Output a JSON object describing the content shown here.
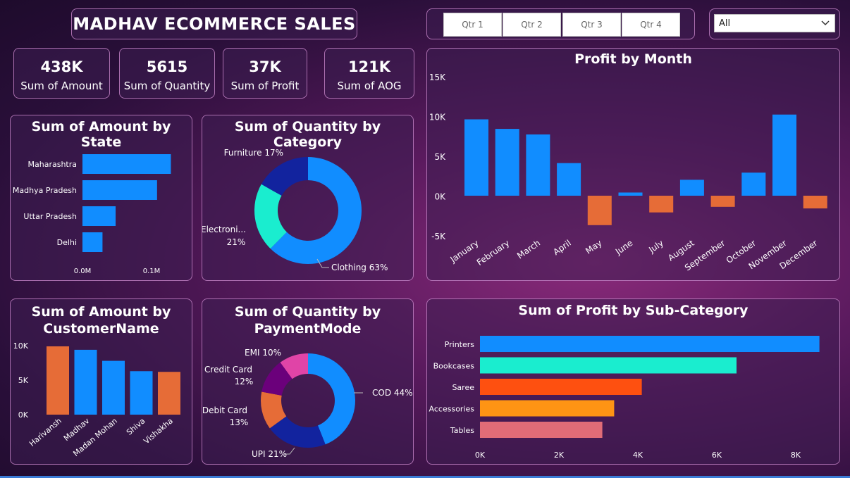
{
  "dashboard": {
    "title": "MADHAV ECOMMERCE SALES"
  },
  "kpis": [
    {
      "value": "438K",
      "label": "Sum of Amount"
    },
    {
      "value": "5615",
      "label": "Sum of Quantity"
    },
    {
      "value": "37K",
      "label": "Sum of Profit"
    },
    {
      "value": "121K",
      "label": "Sum of AOG"
    }
  ],
  "quarters": [
    "Qtr 1",
    "Qtr 2",
    "Qtr 3",
    "Qtr 4"
  ],
  "filter": {
    "selected": "All"
  },
  "colors": {
    "blue": "#118dff",
    "orange": "#e66c37",
    "navy": "#12239e",
    "teal": "#1aedcf",
    "red": "#fe5010",
    "amber": "#fe9414",
    "pink": "#e06c77",
    "purple": "#6b007b",
    "magenta": "#e044a7"
  },
  "chart_data": [
    {
      "type": "bar",
      "orientation": "horizontal",
      "title": "Sum of Amount by State",
      "categories": [
        "Maharashtra",
        "Madhya Pradesh",
        "Uttar Pradesh",
        "Delhi"
      ],
      "values": [
        0.128,
        0.108,
        0.048,
        0.029
      ],
      "xticks": [
        "0.0M",
        "0.1M"
      ],
      "xlim": [
        0,
        0.13
      ]
    },
    {
      "type": "pie",
      "donut": true,
      "title": "Sum of Quantity by Category",
      "slices": [
        {
          "label": "Clothing",
          "pct": 63,
          "text": "Clothing 63%",
          "color": "#118dff"
        },
        {
          "label": "Electronics",
          "pct": 21,
          "text1": "Electroni...",
          "text2": "21%",
          "color": "#1aedcf"
        },
        {
          "label": "Furniture",
          "pct": 17,
          "text": "Furniture 17%",
          "color": "#12239e"
        }
      ]
    },
    {
      "type": "bar",
      "title": "Profit by Month",
      "categories": [
        "January",
        "February",
        "March",
        "April",
        "May",
        "June",
        "July",
        "August",
        "September",
        "October",
        "November",
        "December"
      ],
      "values": [
        9600,
        8400,
        7700,
        4100,
        -3700,
        400,
        -2100,
        2000,
        -1400,
        2900,
        10200,
        -1600
      ],
      "yticks": [
        "15K",
        "10K",
        "5K",
        "0K",
        "-5K"
      ],
      "ylim": [
        -5000,
        15000
      ]
    },
    {
      "type": "bar",
      "title": "Sum of Amount by CustomerName",
      "title_lines": [
        "Sum of Amount by",
        "CustomerName"
      ],
      "categories": [
        "Harivansh",
        "Madhav",
        "Madan Mohan",
        "Shiva",
        "Vishakha"
      ],
      "values": [
        9900,
        9400,
        7800,
        6300,
        6200
      ],
      "yticks": [
        "10K",
        "5K",
        "0K"
      ],
      "ylim": [
        0,
        10000
      ]
    },
    {
      "type": "pie",
      "donut": true,
      "title": "Sum of Quantity by PaymentMode",
      "title_lines": [
        "Sum of Quantity by",
        "PaymentMode"
      ],
      "slices": [
        {
          "label": "COD",
          "pct": 44,
          "text": "COD 44%",
          "color": "#118dff"
        },
        {
          "label": "UPI",
          "pct": 21,
          "text": "UPI 21%",
          "color": "#12239e"
        },
        {
          "label": "Debit Card",
          "pct": 13,
          "text1": "Debit Card",
          "text2": "13%",
          "color": "#e66c37"
        },
        {
          "label": "Credit Card",
          "pct": 12,
          "text1": "Credit Card",
          "text2": "12%",
          "color": "#6b007b"
        },
        {
          "label": "EMI",
          "pct": 10,
          "text": "EMI 10%",
          "color": "#e044a7"
        }
      ]
    },
    {
      "type": "bar",
      "orientation": "horizontal",
      "title": "Sum of Profit by Sub-Category",
      "categories": [
        "Printers",
        "Bookcases",
        "Saree",
        "Accessories",
        "Tables"
      ],
      "values": [
        8600,
        6500,
        4100,
        3400,
        3100
      ],
      "xticks": [
        "0K",
        "2K",
        "4K",
        "6K",
        "8K"
      ],
      "xlim": [
        0,
        8000
      ]
    }
  ]
}
